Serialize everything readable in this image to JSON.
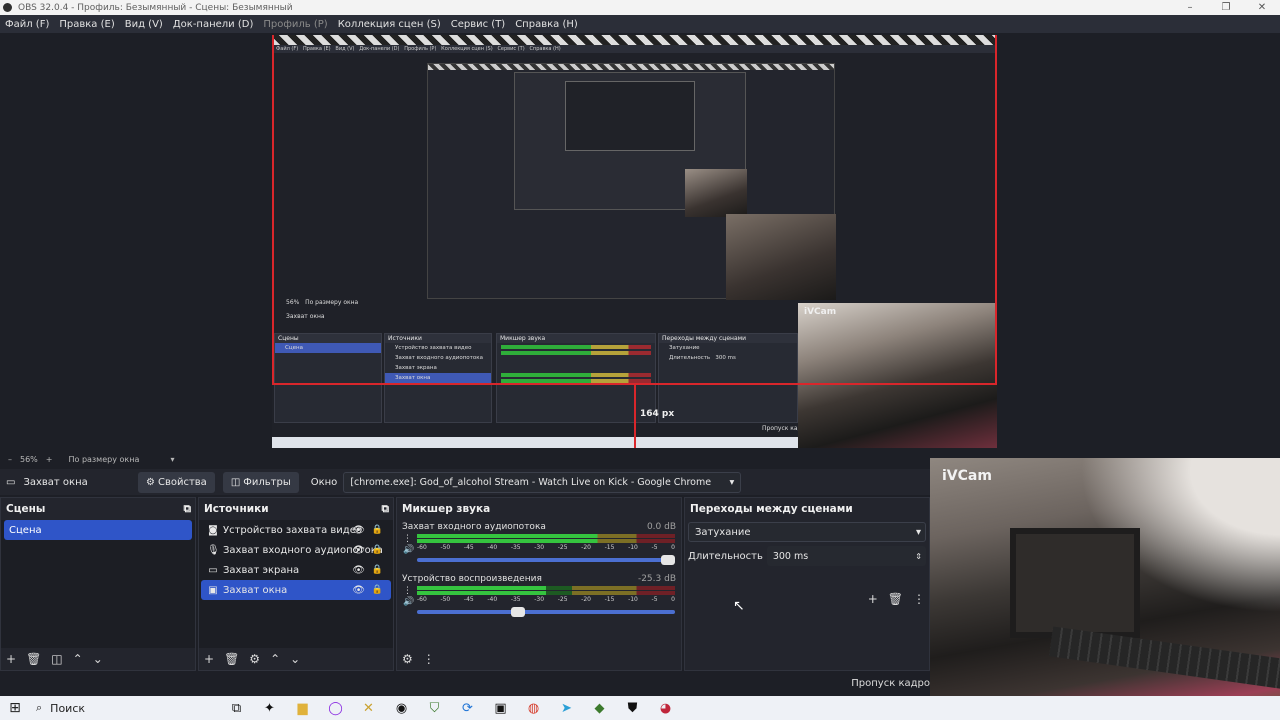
{
  "window": {
    "title": "OBS 32.0.4 - Профиль: Безымянный - Сцены: Безымянный"
  },
  "menu": [
    {
      "label": "Файл (F)",
      "disabled": false
    },
    {
      "label": "Правка (E)",
      "disabled": false
    },
    {
      "label": "Вид (V)",
      "disabled": false
    },
    {
      "label": "Док-панели (D)",
      "disabled": false
    },
    {
      "label": "Профиль (P)",
      "disabled": true
    },
    {
      "label": "Коллекция сцен (S)",
      "disabled": false
    },
    {
      "label": "Сервис (T)",
      "disabled": false
    },
    {
      "label": "Справка (H)",
      "disabled": false
    }
  ],
  "preview": {
    "camera_label": "iVCam",
    "px_label": "164 px",
    "inner_zoom": "56%",
    "inner_fit": "По размеру окна",
    "inner_source": "Захват окна",
    "inner_scenes_title": "Сцены",
    "inner_scene": "Сцена",
    "inner_sources_title": "Источники",
    "inner_sources": [
      "Устройство захвата видео",
      "Захват входного аудиопотока",
      "Захват экрана",
      "Захват окна"
    ],
    "inner_mixer_title": "Микшер звука",
    "inner_transitions_title": "Переходы между сценами",
    "inner_transition": "Затухание",
    "inner_duration_label": "Длительность",
    "inner_duration": "300 ms",
    "inner_drop": "Пропуск кадров"
  },
  "zoom": {
    "level": "56%",
    "fit": "По размеру окна"
  },
  "source_toolbar": {
    "source_name": "Захват окна",
    "properties": "Свойства",
    "filters": "Фильтры",
    "window_label": "Окно",
    "window_value": "[chrome.exe]: God_of_alcohol Stream - Watch Live on Kick - Google Chrome"
  },
  "scenes": {
    "title": "Сцены",
    "items": [
      "Сцена"
    ]
  },
  "sources": {
    "title": "Источники",
    "items": [
      {
        "label": "Устройство захвата видео",
        "icon": "camera-icon"
      },
      {
        "label": "Захват входного аудиопотока",
        "icon": "microphone-icon"
      },
      {
        "label": "Захват экрана",
        "icon": "monitor-icon"
      },
      {
        "label": "Захват окна",
        "icon": "window-icon"
      }
    ]
  },
  "mixer": {
    "title": "Микшер звука",
    "ticks": [
      "-60",
      "-50",
      "-45",
      "-40",
      "-35",
      "-30",
      "-25",
      "-20",
      "-15",
      "-10",
      "-5",
      "0"
    ],
    "channels": [
      {
        "name": "Захват входного аудиопотока",
        "db": "0.0 dB",
        "level": 1.0,
        "meter_fill": 0.7
      },
      {
        "name": "Устройство воспроизведения",
        "db": "-25.3 dB",
        "level": 0.42,
        "meter_fill": 0.5
      }
    ]
  },
  "transitions": {
    "title": "Переходы между сценами",
    "selected": "Затухание",
    "duration_label": "Длительность",
    "duration_value": "300 ms"
  },
  "statusbar": {
    "dropped": "Пропуск кадро"
  },
  "webcam": {
    "label": "iVCam"
  },
  "taskbar": {
    "search": "Поиск"
  }
}
